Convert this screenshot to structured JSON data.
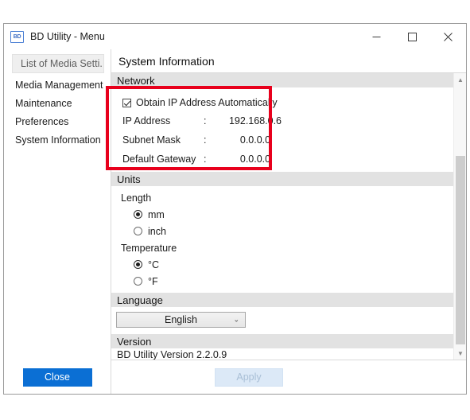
{
  "window": {
    "icon_text": "BD",
    "title": "BD Utility - Menu",
    "controls": {
      "minimize": "minimize-button",
      "maximize": "maximize-button",
      "close": "close-button"
    }
  },
  "sidebar": {
    "items": [
      {
        "label": "List of Media Setti...",
        "selected_header": true
      },
      {
        "label": "Media Management",
        "selected_header": false
      },
      {
        "label": "Maintenance",
        "selected_header": false
      },
      {
        "label": "Preferences",
        "selected_header": false
      },
      {
        "label": "System Information",
        "selected_header": false
      }
    ]
  },
  "pane": {
    "title": "System Information",
    "network": {
      "header": "Network",
      "obtain_auto_label": "Obtain IP Address Automatically",
      "obtain_auto_checked": true,
      "fields": [
        {
          "label": "IP Address",
          "colon": ":",
          "value": "192.168.0.6"
        },
        {
          "label": "Subnet Mask",
          "colon": ":",
          "value": "0.0.0.0"
        },
        {
          "label": "Default Gateway",
          "colon": ":",
          "value": "0.0.0.0"
        }
      ]
    },
    "units": {
      "header": "Units",
      "length_label": "Length",
      "length_options": [
        {
          "label": "mm",
          "selected": true
        },
        {
          "label": "inch",
          "selected": false
        }
      ],
      "temperature_label": "Temperature",
      "temperature_options": [
        {
          "label": "°C",
          "selected": true
        },
        {
          "label": "°F",
          "selected": false
        }
      ]
    },
    "language": {
      "header": "Language",
      "selected": "English",
      "chevron": "⌄"
    },
    "version": {
      "header": "Version",
      "text": "BD Utility Version 2.2.0.9"
    }
  },
  "footer": {
    "close_label": "Close",
    "apply_label": "Apply"
  },
  "annotation": {
    "highlight_color": "#e8001c",
    "target": "network-settings-group"
  }
}
